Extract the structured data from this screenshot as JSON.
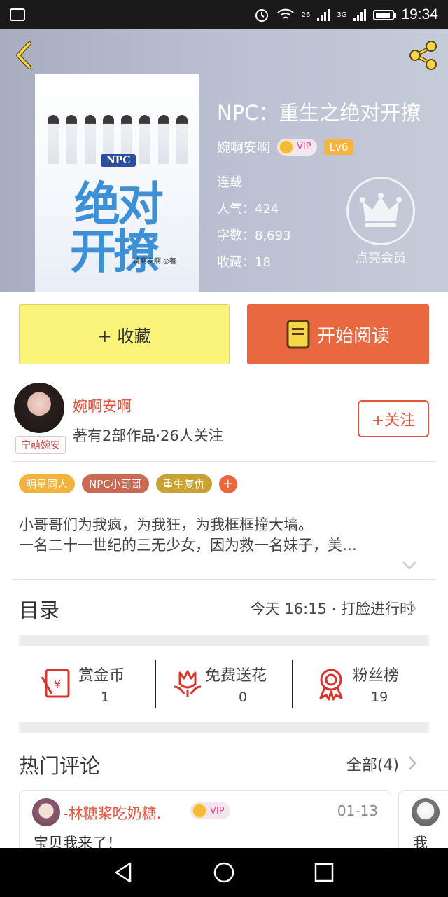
{
  "status_bar": {
    "time": "19:34",
    "net1": "26",
    "net2": "3G"
  },
  "book": {
    "title": "NPC：重生之绝对开撩",
    "author": "婉啊安啊",
    "vip_label": "VIP",
    "level": "Lv6",
    "status": "连载",
    "popularity": "人气：424",
    "word_count": "字数：8,693",
    "favorites": "收藏：18",
    "member_label": "点亮会员",
    "cover": {
      "badge": "NPC",
      "title_line1": "绝对",
      "title_line2": "开撩",
      "author_mark": "婉啊安啊 ◎著"
    }
  },
  "actions": {
    "favorite_label": "+ 收藏",
    "read_label": "开始阅读"
  },
  "author_card": {
    "name": "婉啊安啊",
    "stats": "著有2部作品·26人关注",
    "avatar_tag": "宁萌婉安",
    "follow_label": "+关注"
  },
  "tags": [
    {
      "label": "明星同人",
      "color": "#f3b23a"
    },
    {
      "label": "NPC小哥哥",
      "color": "#c96a55"
    },
    {
      "label": "重生复仇",
      "color": "#c9a233"
    }
  ],
  "tag_add_label": "+",
  "intro": {
    "line1": "小哥哥们为我疯，为我狂，为我框框撞大墙。",
    "line2": "一名二十一世纪的三无少女，因为救一名妹子，美…"
  },
  "toc": {
    "title": "目录",
    "latest": "今天 16:15 · 打脸进行时"
  },
  "stats": [
    {
      "label": "赏金币",
      "value": "1"
    },
    {
      "label": "免费送花",
      "value": "0"
    },
    {
      "label": "粉丝榜",
      "value": "19"
    }
  ],
  "comments": {
    "title": "热门评论",
    "all_label": "全部(4)",
    "items": [
      {
        "user": "-林糖桨吃奶糖.",
        "vip": "VIP",
        "date": "01-13",
        "text": "宝贝我来了！"
      },
      {
        "text": "我"
      }
    ]
  },
  "colors": {
    "accent": "#ea6840",
    "author_red": "#e2553e",
    "fav_yellow": "#fbf47a"
  }
}
